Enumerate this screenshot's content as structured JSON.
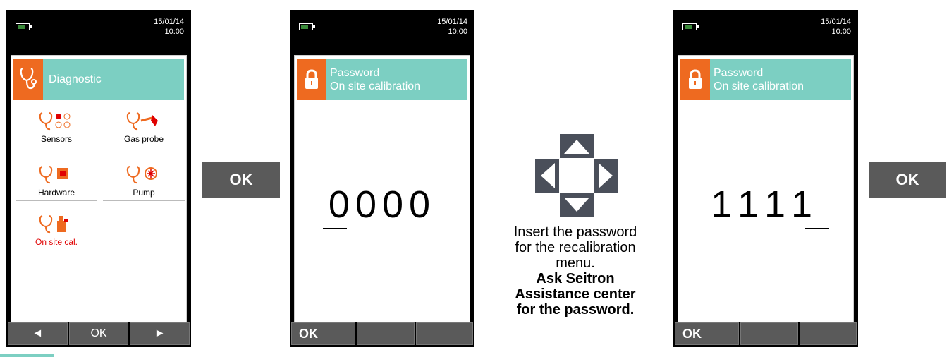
{
  "screens": [
    {
      "date": "15/01/14",
      "time": "10:00",
      "header_title": "Diagnostic",
      "items": [
        {
          "label": "Sensors"
        },
        {
          "label": "Gas probe"
        },
        {
          "label": "Hardware"
        },
        {
          "label": "Pump"
        },
        {
          "label": "On site cal."
        }
      ],
      "softkeys": [
        "◄",
        "OK",
        "►"
      ]
    },
    {
      "date": "15/01/14",
      "time": "10:00",
      "header_line1": "Password",
      "header_line2": "On site calibration",
      "digits": "0000",
      "softkeys": [
        "OK",
        "",
        ""
      ]
    },
    {
      "date": "15/01/14",
      "time": "10:00",
      "header_line1": "Password",
      "header_line2": "On site calibration",
      "digits": "1111",
      "softkeys": [
        "OK",
        "",
        ""
      ]
    }
  ],
  "ok_buttons": [
    "OK",
    "OK"
  ],
  "caption": {
    "line1": "Insert the password",
    "line2": "for the recalibration",
    "line3": "menu.",
    "bold1": "Ask Seitron",
    "bold2": "Assistance center",
    "bold3": "for the password."
  },
  "colors": {
    "accent": "#7ccfc2",
    "icon_bg": "#ee6a20",
    "softkey": "#5a5a5a",
    "highlight": "#e00000"
  }
}
